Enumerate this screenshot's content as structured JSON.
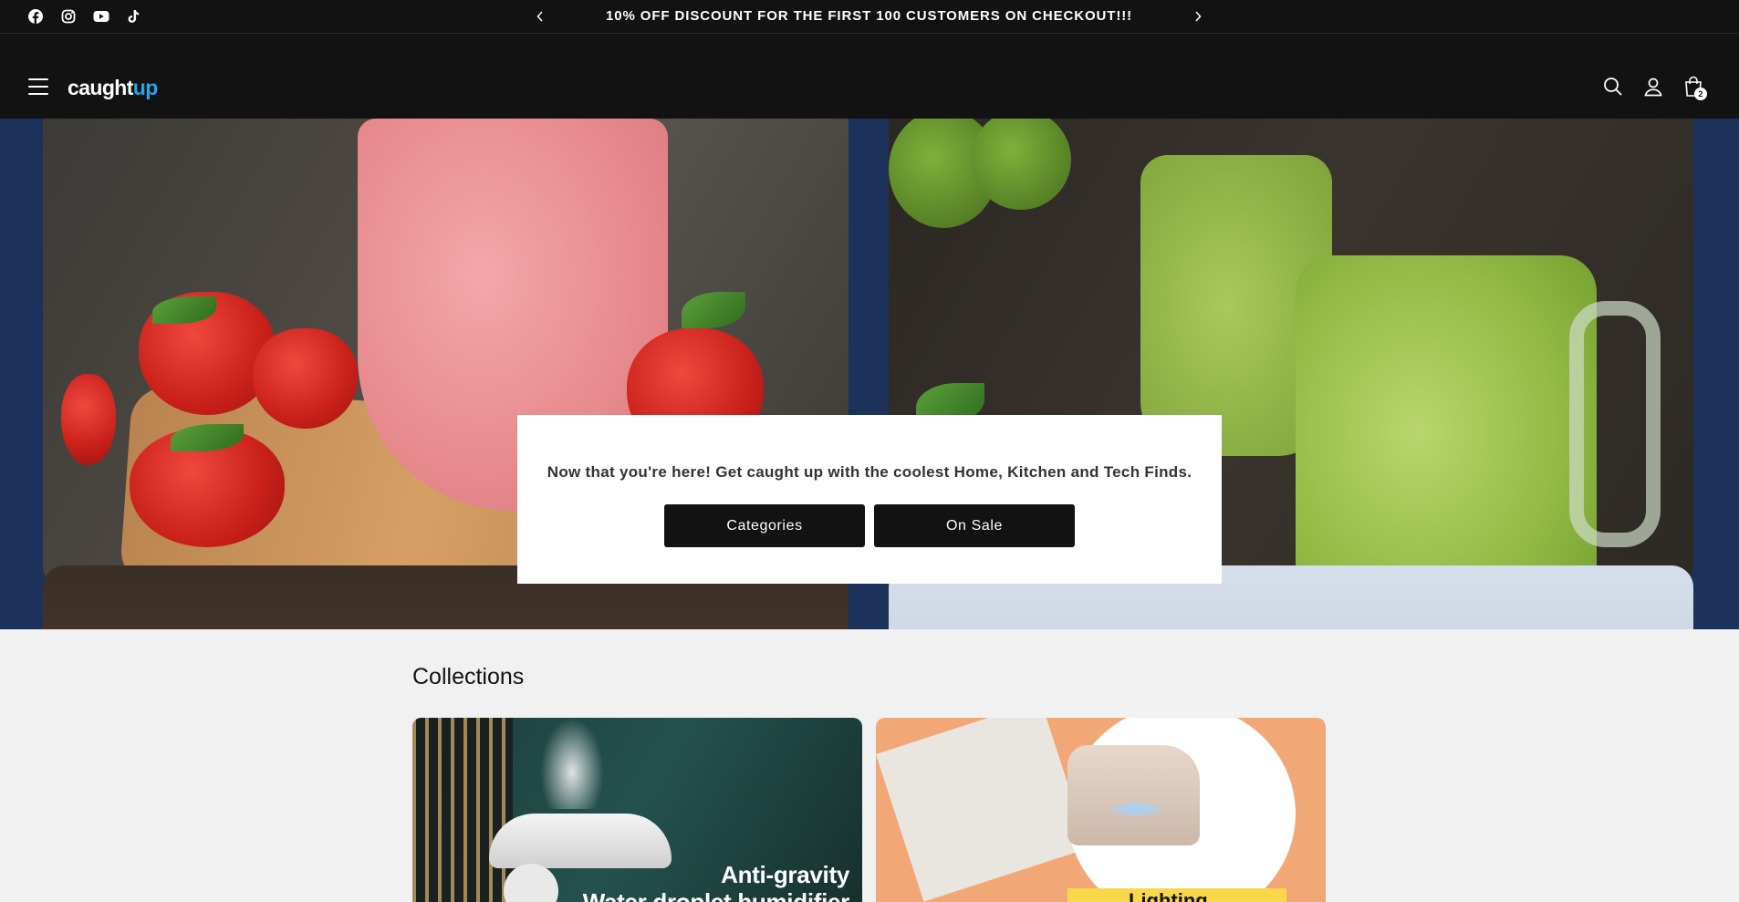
{
  "announcement": {
    "message": "10% OFF DISCOUNT FOR THE FIRST 100 CUSTOMERS ON CHECKOUT!!!",
    "social_icons": [
      "facebook-icon",
      "instagram-icon",
      "youtube-icon",
      "tiktok-icon"
    ]
  },
  "header": {
    "logo_main": "caught",
    "logo_accent": "up",
    "cart_count": "2",
    "icons": [
      "menu-icon",
      "search-icon",
      "account-icon",
      "cart-icon"
    ]
  },
  "hero": {
    "modal_text": "Now that you're here! Get caught up with the coolest Home, Kitchen and Tech Finds.",
    "buttons": [
      "Categories",
      "On Sale"
    ]
  },
  "collections": {
    "title": "Collections",
    "cards": [
      {
        "caption_line1": "Anti-gravity",
        "caption_line2": "Water droplet humidifier"
      },
      {
        "caption": "Lighting"
      }
    ]
  },
  "colors": {
    "header_bg": "#121212",
    "hero_bg": "#1d325a",
    "logo_accent": "#27a4e8",
    "page_bg": "#f1f1f1"
  }
}
